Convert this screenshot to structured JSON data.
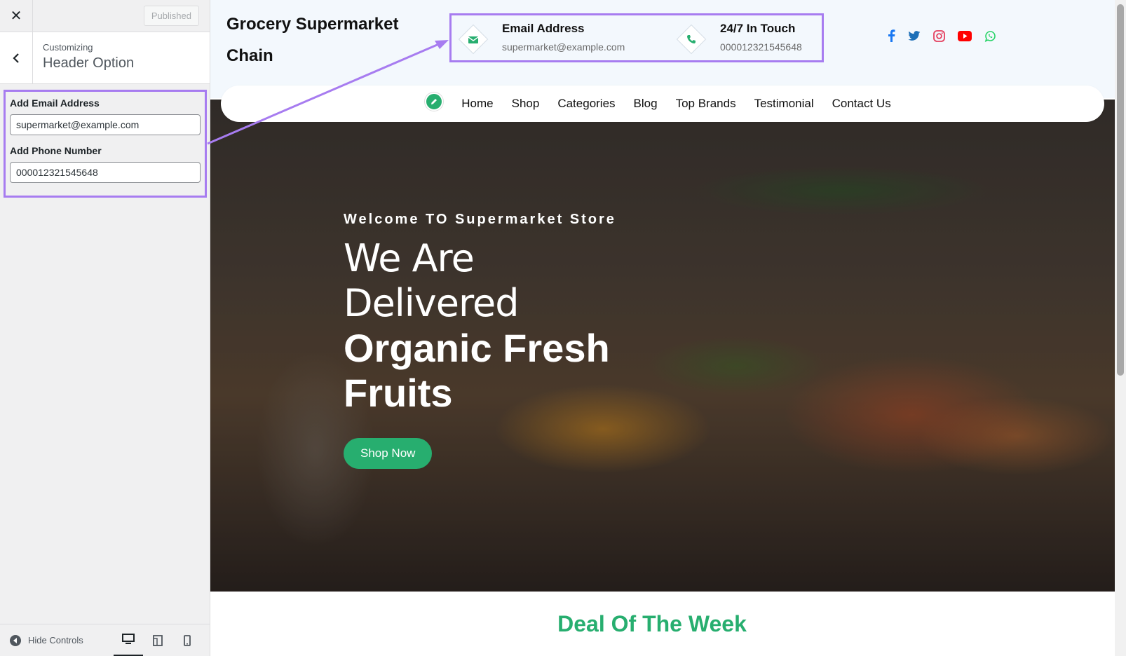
{
  "customizer": {
    "close_label": "✕",
    "published_label": "Published",
    "breadcrumb": "Customizing",
    "section_title": "Header Option",
    "fields": [
      {
        "label": "Add Email Address",
        "value": "supermarket@example.com"
      },
      {
        "label": "Add Phone Number",
        "value": "000012321545648"
      }
    ],
    "hide_controls_label": "Hide Controls",
    "devices": [
      "desktop-icon",
      "tablet-icon",
      "mobile-icon"
    ],
    "active_device": "desktop"
  },
  "site": {
    "title": "Grocery Supermarket Chain",
    "contact": [
      {
        "title": "Email Address",
        "value": "supermarket@example.com",
        "icon": "envelope-icon"
      },
      {
        "title": "24/7 In Touch",
        "value": "000012321545648",
        "icon": "phone-icon"
      }
    ],
    "socials": [
      "facebook-icon",
      "twitter-icon",
      "instagram-icon",
      "youtube-icon",
      "whatsapp-icon"
    ],
    "nav": [
      "Home",
      "Shop",
      "Categories",
      "Blog",
      "Top Brands",
      "Testimonial",
      "Contact Us"
    ],
    "hero": {
      "welcome": "Welcome TO Supermarket Store",
      "line1a": "We Are",
      "line1b": "Delivered",
      "line2a": "Organic Fresh",
      "line2b": "Fruits",
      "button": "Shop Now"
    },
    "deal_title": "Deal Of The Week"
  },
  "colors": {
    "accent_green": "#27ae6f",
    "highlight_purple": "#a77cf0"
  }
}
